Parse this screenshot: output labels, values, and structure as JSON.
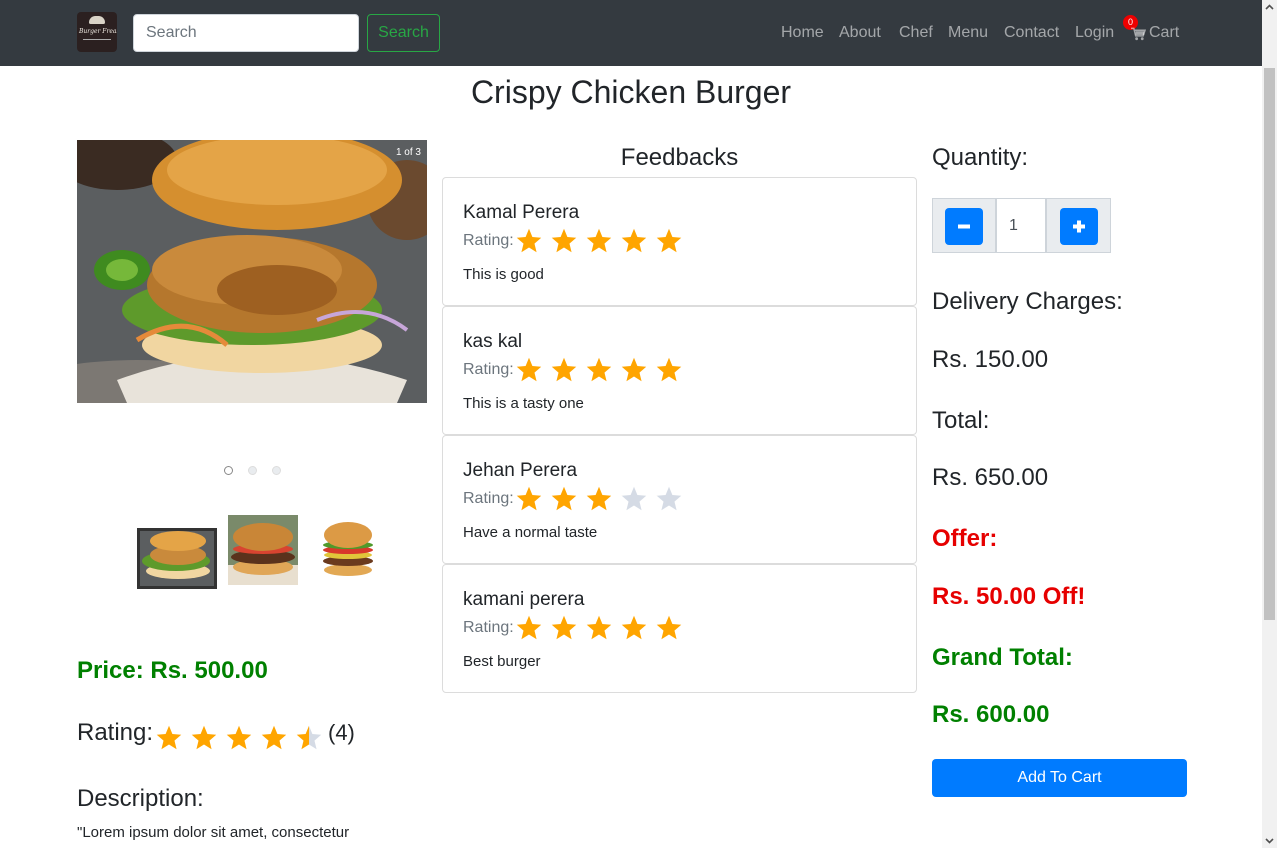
{
  "nav": {
    "logo_text": "Burger Freaks",
    "search_placeholder": "Search",
    "search_button": "Search",
    "links": [
      "Home",
      "About",
      "Chef",
      "Menu",
      "Contact",
      "Login"
    ],
    "cart_label": "Cart",
    "cart_count": "0"
  },
  "product": {
    "title": "Crispy Chicken Burger",
    "carousel_counter": "1 of 3",
    "carousel_total": 3,
    "carousel_active": 1,
    "price_text": "Price: Rs. 500.00",
    "rating_label": "Rating:",
    "rating_value": 4.5,
    "rating_count": "(4)",
    "description_label": "Description:",
    "description_text": "\"Lorem ipsum dolor sit amet, consectetur"
  },
  "feedbacks": {
    "heading": "Feedbacks",
    "rating_label": "Rating:",
    "items": [
      {
        "name": "Kamal Perera",
        "rating": 5,
        "comment": "This is good"
      },
      {
        "name": "kas kal",
        "rating": 5,
        "comment": "This is a tasty one"
      },
      {
        "name": "Jehan Perera",
        "rating": 3,
        "comment": "Have a normal taste"
      },
      {
        "name": "kamani perera",
        "rating": 5,
        "comment": "Best burger"
      }
    ]
  },
  "order": {
    "quantity_label": "Quantity:",
    "quantity_value": "1",
    "delivery_label": "Delivery Charges:",
    "delivery_value": "Rs. 150.00",
    "total_label": "Total:",
    "total_value": "Rs. 650.00",
    "offer_label": "Offer:",
    "offer_value": "Rs. 50.00 Off!",
    "grand_total_label": "Grand Total:",
    "grand_total_value": "Rs. 600.00",
    "add_to_cart": "Add To Cart"
  },
  "colors": {
    "star": "#ffa500",
    "star_empty": "#d5dbe5",
    "price_green": "#008000",
    "offer_red": "#e60000",
    "primary": "#007bff",
    "navbar": "#343a40"
  }
}
